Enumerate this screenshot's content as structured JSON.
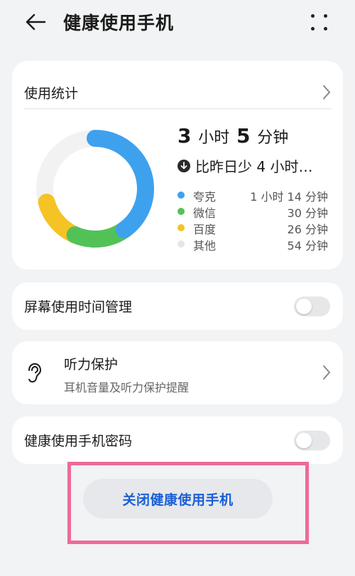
{
  "header": {
    "title": "健康使用手机",
    "back_icon": "arrow-left-icon",
    "more_icon": "more-vertical-dots-icon"
  },
  "stats": {
    "title": "使用统计",
    "total_hours": "3",
    "hours_unit": "小时",
    "total_minutes": "5",
    "minutes_unit": "分钟",
    "compare_text": "比昨日少 4 小时…",
    "apps": [
      {
        "name": "夸克",
        "time": "1 小时 14 分钟",
        "color": "#3ea1ee",
        "minutes": 74
      },
      {
        "name": "微信",
        "time": "30 分钟",
        "color": "#52c257",
        "minutes": 30
      },
      {
        "name": "百度",
        "time": "26 分钟",
        "color": "#f5c324",
        "minutes": 26
      },
      {
        "name": "其他",
        "time": "54 分钟",
        "color": "#eeeeee",
        "minutes": 54
      }
    ]
  },
  "screen_time": {
    "label": "屏幕使用时间管理",
    "enabled": false
  },
  "hearing": {
    "title": "听力保护",
    "subtitle": "耳机音量及听力保护提醒",
    "icon": "ear-icon"
  },
  "password": {
    "label": "健康使用手机密码",
    "enabled": false
  },
  "close_button": {
    "label": "关闭健康使用手机"
  },
  "colors": {
    "accent": "#1a5fd6",
    "highlight": "#ee6a98",
    "background": "#f1f3f5"
  }
}
